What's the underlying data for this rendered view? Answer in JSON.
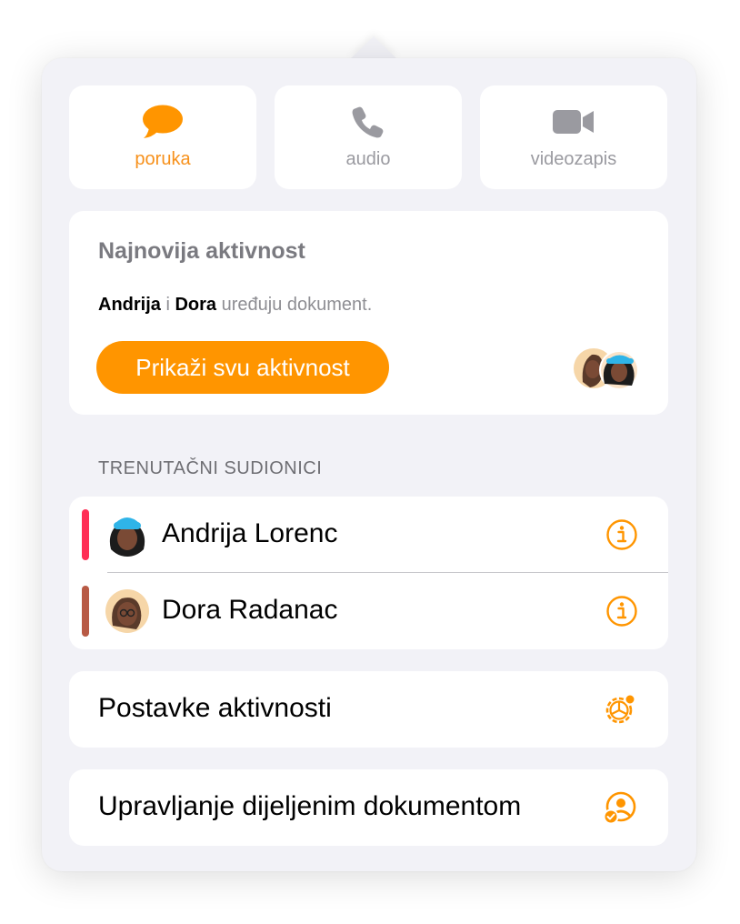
{
  "comm_buttons": {
    "message": {
      "label": "poruka",
      "icon": "speech-bubble-icon"
    },
    "audio": {
      "label": "audio",
      "icon": "phone-icon"
    },
    "video": {
      "label": "videozapis",
      "icon": "video-camera-icon"
    }
  },
  "activity": {
    "title": "Najnovija aktivnost",
    "name1": "Andrija",
    "conj": " i ",
    "name2": "Dora",
    "rest": " uređuju dokument.",
    "button_label": "Prikaži svu aktivnost"
  },
  "participants": {
    "header": "TRENUTAČNI SUDIONICI",
    "items": [
      {
        "name": "Andrija Lorenc",
        "color": "#ff2d55",
        "avatar": "memoji-avatar"
      },
      {
        "name": "Dora Radanac",
        "color": "#b85a45",
        "avatar": "memoji-avatar"
      }
    ]
  },
  "settings": {
    "label": "Postavke aktivnosti",
    "icon": "activity-settings-icon"
  },
  "manage": {
    "label": "Upravljanje dijeljenim dokumentom",
    "icon": "manage-shared-icon"
  },
  "colors": {
    "accent": "#ff9500",
    "accent_text": "#f7901a",
    "background": "#f2f2f7"
  }
}
